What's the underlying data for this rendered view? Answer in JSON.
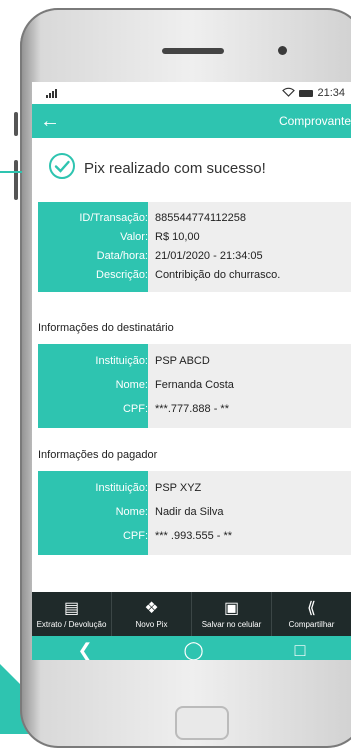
{
  "status": {
    "time": "21:34"
  },
  "appbar": {
    "back_icon": "arrow-left-icon",
    "title": "Comprovante"
  },
  "success": {
    "message": "Pix realizado com sucesso!"
  },
  "transaction": [
    {
      "label": "ID/Transação:",
      "value": "885544774112258"
    },
    {
      "label": "Valor:",
      "value": "R$ 10,00"
    },
    {
      "label": "Data/hora:",
      "value": "21/01/2020 - 21:34:05"
    },
    {
      "label": "Descrição:",
      "value": "Contribição do churrasco."
    }
  ],
  "recipient": {
    "title": "Informações do destinatário",
    "rows": [
      {
        "label": "Instituição:",
        "value": "PSP ABCD"
      },
      {
        "label": "Nome:",
        "value": "Fernanda Costa"
      },
      {
        "label": "CPF:",
        "value": "***.777.888 - **"
      }
    ]
  },
  "payer": {
    "title": "Informações do pagador",
    "rows": [
      {
        "label": "Instituição:",
        "value": "PSP XYZ"
      },
      {
        "label": "Nome:",
        "value": "Nadir da Silva"
      },
      {
        "label": "CPF:",
        "value": "*** .993.555 - **"
      }
    ]
  },
  "toolbar": {
    "extrato": "Extrato / Devolução",
    "novo": "Novo Pix",
    "salvar": "Salvar no celular",
    "compartilhar": "Compartilhar"
  },
  "colors": {
    "accent": "#2ec4b0",
    "toolbar": "#1f2a2a"
  }
}
